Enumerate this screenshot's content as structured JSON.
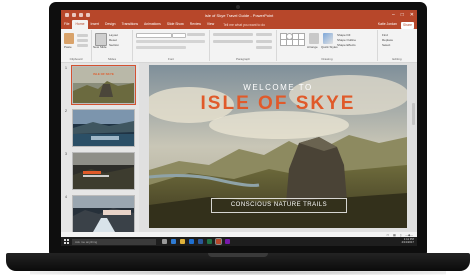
{
  "window": {
    "title": "Isle of Skye Travel Guide - PowerPoint",
    "controls": [
      "–",
      "□",
      "✕"
    ]
  },
  "tabs": [
    "File",
    "Home",
    "Insert",
    "Design",
    "Transitions",
    "Animations",
    "Slide Show",
    "Review",
    "View"
  ],
  "tell_me": "Tell me what you want to do",
  "user": "Katie Jordan",
  "share_label": "Share",
  "ribbon_groups": [
    "Clipboard",
    "Slides",
    "Font",
    "Paragraph",
    "Drawing",
    "Editing"
  ],
  "ribbon": {
    "paste": "Paste",
    "new_slide": "New Slide",
    "layout": "Layout",
    "reset": "Reset",
    "section": "Section",
    "find": "Find",
    "replace": "Replace",
    "select": "Select",
    "arrange": "Arrange",
    "quick_styles": "Quick Styles",
    "shape_fill": "Shape Fill",
    "shape_outline": "Shape Outline",
    "shape_effects": "Shape Effects"
  },
  "slide": {
    "welcome": "WELCOME TO",
    "title": "ISLE OF SKYE",
    "subtitle": "CONSCIOUS NATURE TRAILS"
  },
  "thumbnails": [
    {
      "num": "1",
      "caption": "ISLE OF SKYE"
    },
    {
      "num": "2",
      "caption": ""
    },
    {
      "num": "3",
      "caption": ""
    },
    {
      "num": "4",
      "caption": ""
    }
  ],
  "taskbar": {
    "search_placeholder": "Ask me anything",
    "time": "1:11 PM",
    "date": "4/13/2017"
  },
  "colors": {
    "powerpoint_accent": "#b7472a",
    "title_orange": "#e05a2a"
  }
}
